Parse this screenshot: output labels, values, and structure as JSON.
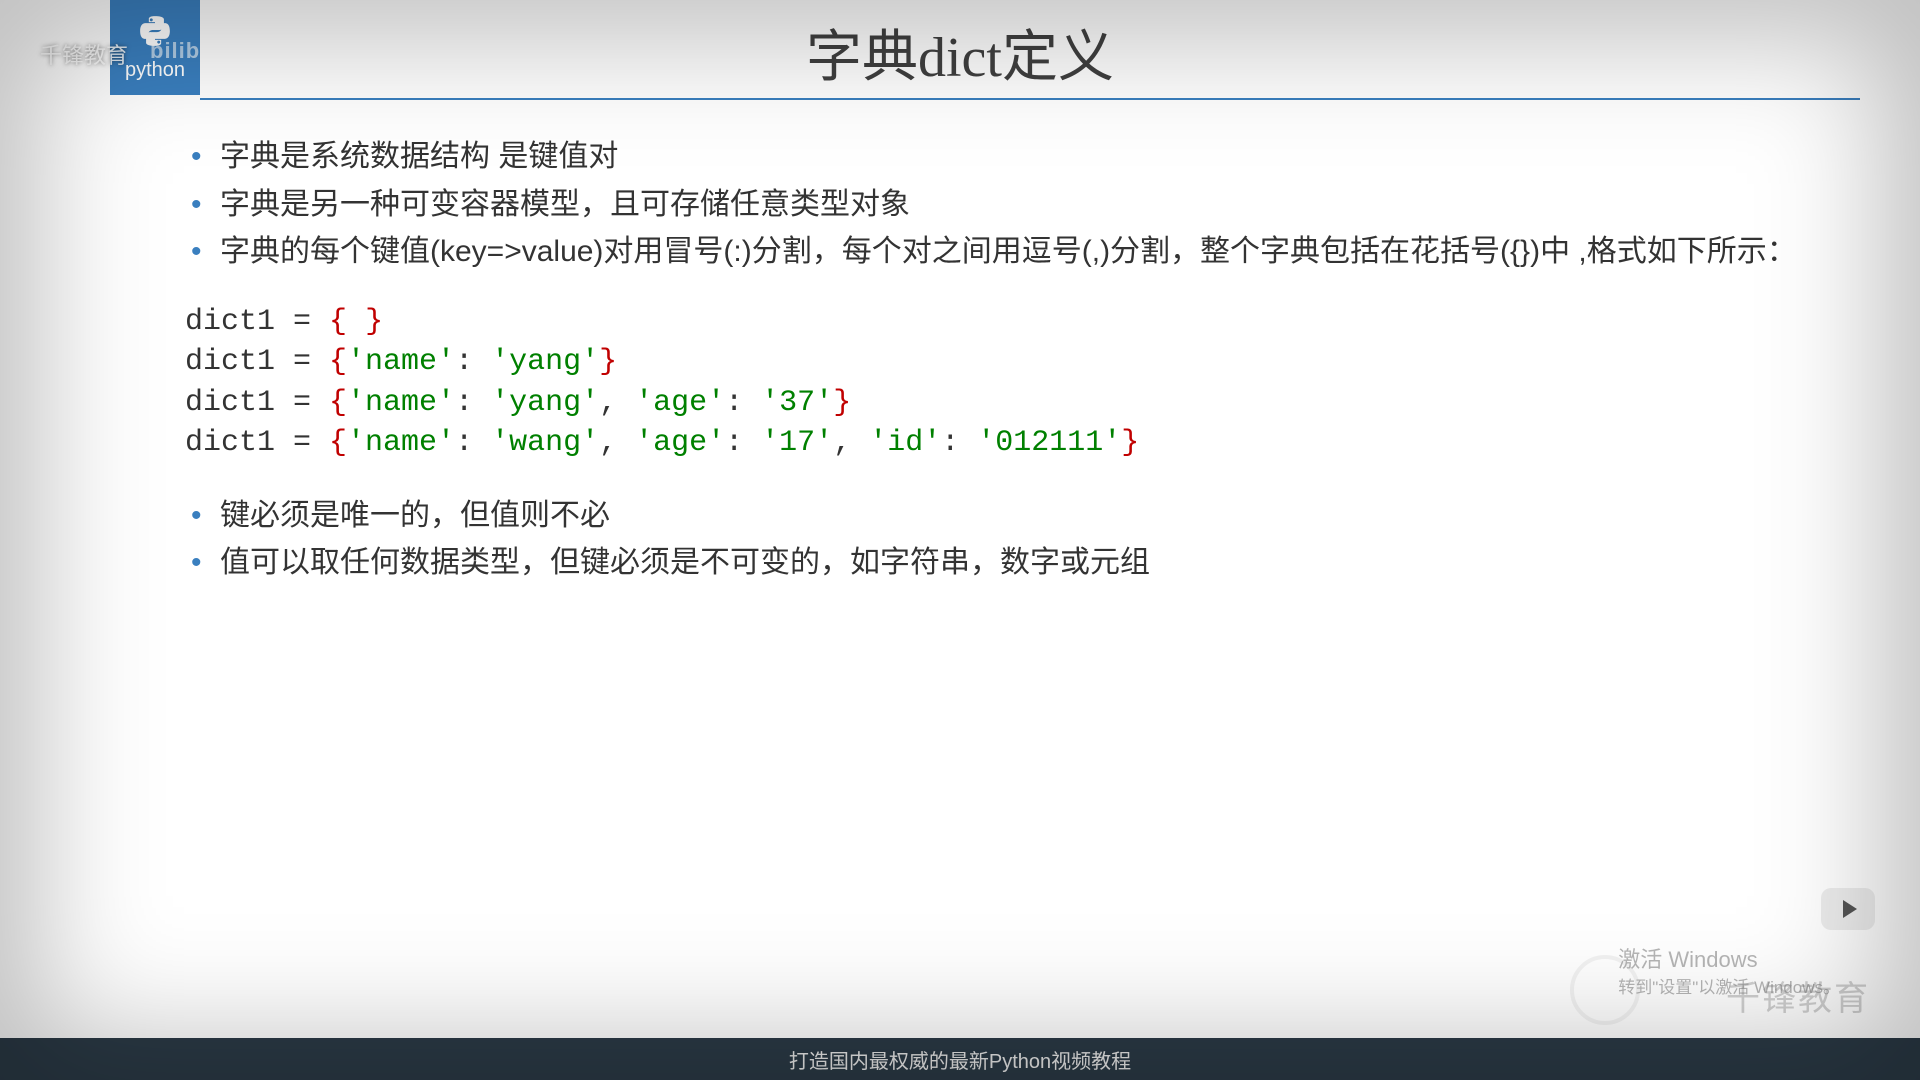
{
  "logo": {
    "icon": "🐍",
    "text": "python"
  },
  "watermarks": {
    "top_left_brand": "千锋教育",
    "bilibili": "bilibili",
    "bottom_right_brand": "千锋教育",
    "windows_line1": "激活 Windows",
    "windows_line2": "转到\"设置\"以激活 Windows。"
  },
  "title": "字典dict定义",
  "bullets_top": [
    "字典是系统数据结构 是键值对",
    "字典是另一种可变容器模型，且可存储任意类型对象",
    "字典的每个键值(key=>value)对用冒号(:)分割，每个对之间用逗号(,)分割，整个字典包括在花括号({})中 ,格式如下所示："
  ],
  "code": {
    "l1_pre": "dict1 = ",
    "l2_pre": "dict1 = ",
    "l3_pre": "dict1 = ",
    "l4_pre": "dict1 = ",
    "brace_open": "{",
    "brace_close": "}",
    "space": " ",
    "nm": "'name'",
    "yg": "'yang'",
    "ag": "'age'",
    "v37": "'37'",
    "wg": "'wang'",
    "v17": "'17'",
    "id": "'id'",
    "vid": "'012111'",
    "colon_sp": ": ",
    "comma_sp": ", "
  },
  "bullets_bottom": [
    "键必须是唯一的，但值则不必",
    "值可以取任何数据类型，但键必须是不可变的，如字符串，数字或元组"
  ],
  "footer": "打造国内最权威的最新Python视频教程"
}
